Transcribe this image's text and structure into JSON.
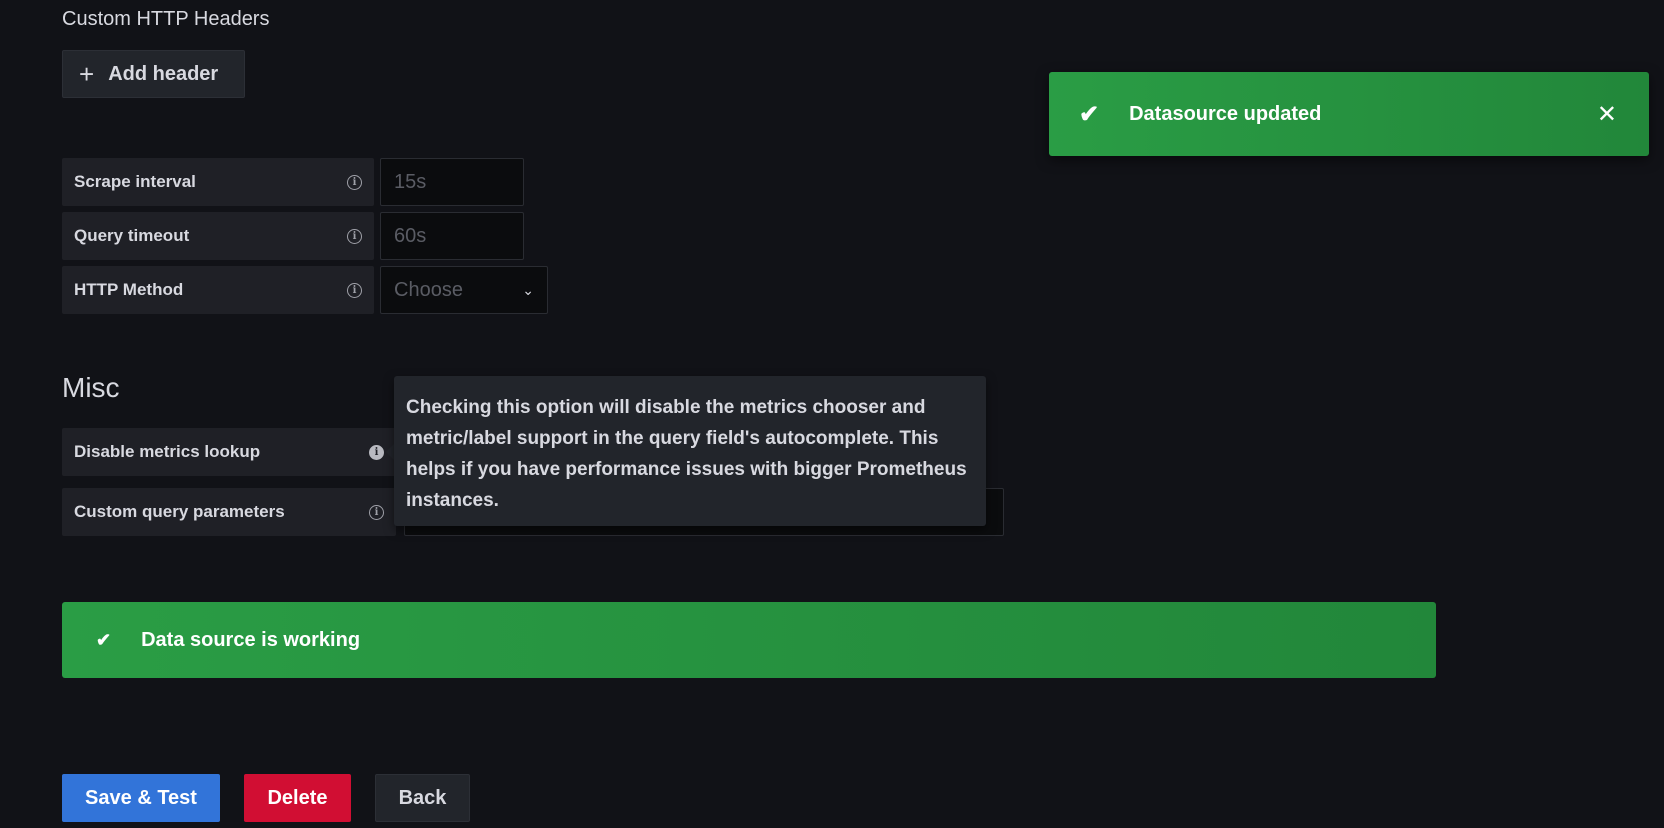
{
  "headers_section": {
    "title": "Custom HTTP Headers",
    "add_header_label": "Add header"
  },
  "fields": {
    "scrape_interval": {
      "label": "Scrape interval",
      "placeholder": "15s"
    },
    "query_timeout": {
      "label": "Query timeout",
      "placeholder": "60s"
    },
    "http_method": {
      "label": "HTTP Method",
      "placeholder": "Choose"
    }
  },
  "misc": {
    "title": "Misc",
    "disable_metrics_lookup_label": "Disable metrics lookup",
    "custom_query_params_label": "Custom query parameters"
  },
  "tooltip": {
    "text": "Checking this option will disable the metrics chooser and metric/label support in the query field's autocomplete. This helps if you have performance issues with bigger Prometheus instances."
  },
  "status": {
    "message": "Data source is working"
  },
  "toast": {
    "message": "Datasource updated"
  },
  "actions": {
    "save_label": "Save & Test",
    "delete_label": "Delete",
    "back_label": "Back"
  },
  "colors": {
    "success": "#2a9d45",
    "primary": "#3274d9",
    "destructive": "#d10e33",
    "background": "#111217"
  }
}
